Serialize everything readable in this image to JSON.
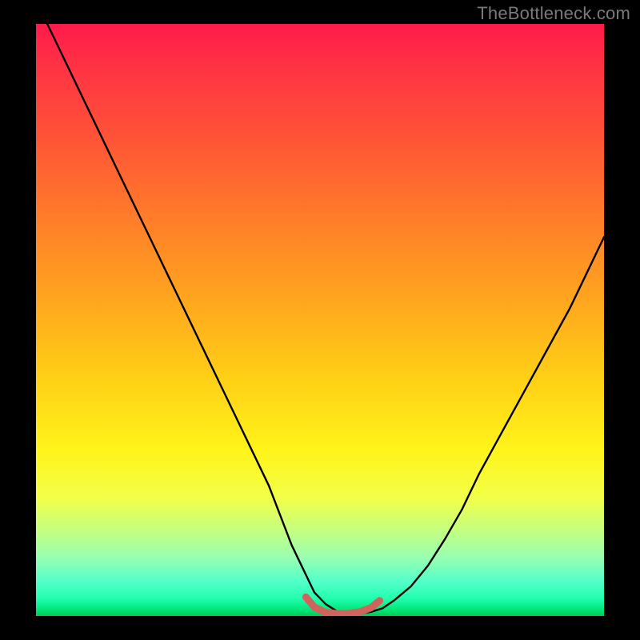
{
  "watermark": "TheBottleneck.com",
  "colors": {
    "frame_bg": "#000000",
    "curve_stroke": "#000000",
    "accent_stroke": "#d1635d",
    "watermark_text": "#7a7a7a",
    "gradient_stops": [
      "#ff1a4a",
      "#ff2f45",
      "#ff5038",
      "#ff7a2a",
      "#ffa41e",
      "#ffd016",
      "#fff41a",
      "#f2ff48",
      "#c8ff7a",
      "#9affb0",
      "#55ffc8",
      "#22ffb0",
      "#00e676",
      "#00c853"
    ]
  },
  "chart_data": {
    "type": "line",
    "title": "",
    "xlabel": "",
    "ylabel": "",
    "xlim": [
      0,
      100
    ],
    "ylim": [
      0,
      100
    ],
    "grid": false,
    "legend": "none",
    "note": "Black V-shaped curve over heatmap-like gradient. x and y normalized 0-100 from plot-area pixels.",
    "series": [
      {
        "name": "main-curve",
        "x": [
          2,
          5,
          8,
          11,
          14,
          17,
          20,
          23,
          26,
          29,
          32,
          35,
          38,
          41,
          43,
          45,
          47,
          49,
          51,
          53,
          55,
          57,
          59,
          61,
          63,
          66,
          69,
          72,
          75,
          78,
          82,
          86,
          90,
          94,
          98,
          100
        ],
        "y": [
          100,
          94,
          88,
          82,
          76,
          70,
          64,
          58,
          52,
          46,
          40,
          34,
          28,
          22,
          17,
          12,
          8,
          4,
          2,
          0.8,
          0.4,
          0.4,
          0.7,
          1.3,
          2.6,
          5.0,
          8.5,
          13,
          18,
          24,
          31,
          38,
          45,
          52,
          60,
          64
        ]
      }
    ],
    "accent_segment": {
      "name": "bottom-accent",
      "description": "Short red/pink rounded stroke hugging the trough of the curve",
      "x": [
        47.5,
        49,
        51,
        53,
        55,
        57,
        59,
        60.5
      ],
      "y": [
        3.2,
        1.5,
        0.6,
        0.4,
        0.4,
        0.7,
        1.4,
        2.6
      ]
    }
  }
}
